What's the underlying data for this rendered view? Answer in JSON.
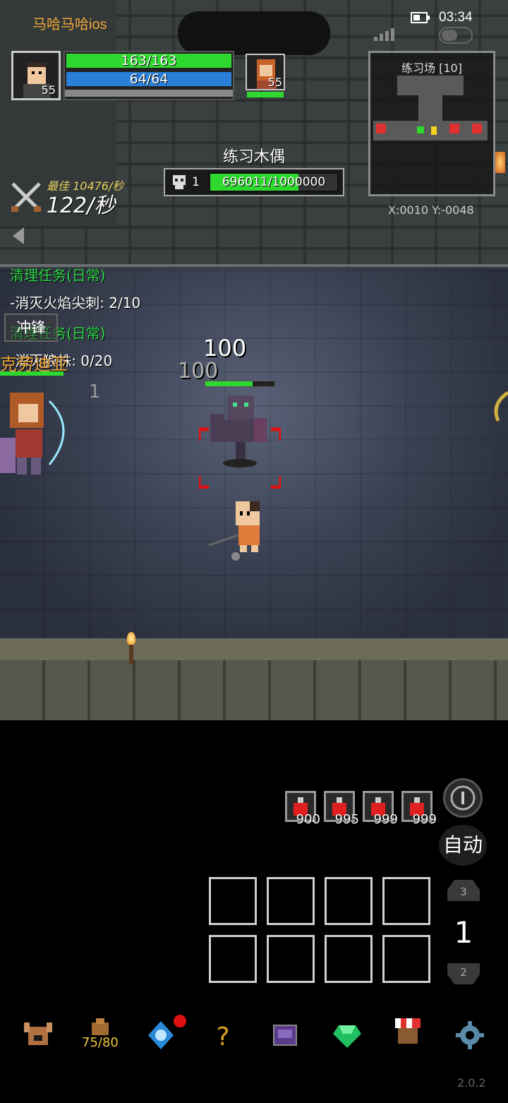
{
  "status_bar": {
    "app_label": "马哈马哈ios",
    "time": "03:34"
  },
  "player": {
    "hp": "163/163",
    "mp": "64/64",
    "level": "55"
  },
  "companion": {
    "level": "55"
  },
  "target": {
    "name": "练习木偶",
    "kill_count": "1",
    "hp": "696011/1000000",
    "hp_fraction": 0.696
  },
  "dps": {
    "best": "最佳 10476/秒",
    "current": "122/秒"
  },
  "minimap": {
    "title": "练习场 [10]",
    "coords": "X:0010  Y:-0048"
  },
  "quests": [
    {
      "title": "清理任务(日常)",
      "line": "-消灭火焰尖刺: 2/10"
    },
    {
      "title": "清理任务(日常)",
      "line": "-消灭狼蛛: 0/20"
    }
  ],
  "skill_label": "冲锋",
  "ally_name": "克劳迪亚",
  "damage_numbers": [
    "100",
    "100",
    "1"
  ],
  "potions": [
    "900",
    "995",
    "999",
    "999"
  ],
  "auto_label": "自动",
  "page": {
    "current": "1",
    "up": "3",
    "down": "2"
  },
  "nav": {
    "bag_count": "75/80"
  },
  "version": "2.0.2"
}
